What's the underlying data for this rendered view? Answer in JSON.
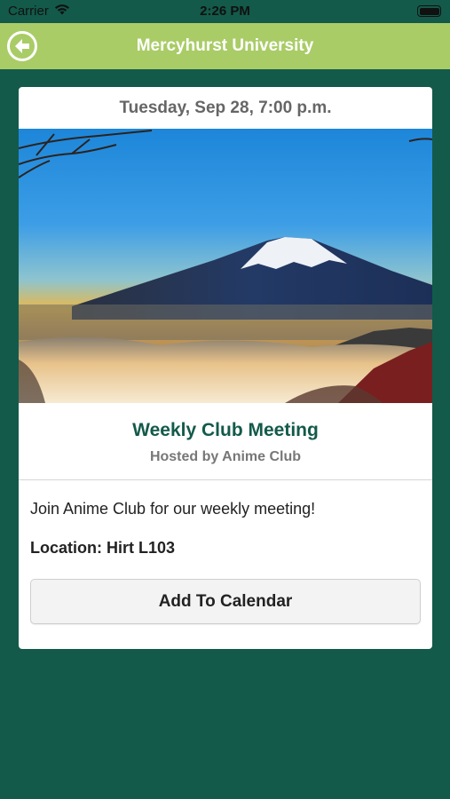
{
  "status_bar": {
    "carrier": "Carrier",
    "time": "2:26 PM",
    "wifi_icon": "wifi-icon",
    "battery_icon": "battery-icon"
  },
  "nav": {
    "title": "Mercyhurst University",
    "back_icon": "back-arrow-icon"
  },
  "event": {
    "date": "Tuesday, Sep 28, 7:00 p.m.",
    "image": "mount-fuji-sunrise-photo",
    "title": "Weekly Club Meeting",
    "host": "Hosted by Anime Club",
    "description": "Join Anime Club for our weekly meeting!",
    "location": "Location: Hirt L103",
    "calendar_button": "Add To Calendar"
  },
  "colors": {
    "background": "#135a4a",
    "nav_bar": "#a9cc67",
    "title_green": "#135a4a"
  }
}
